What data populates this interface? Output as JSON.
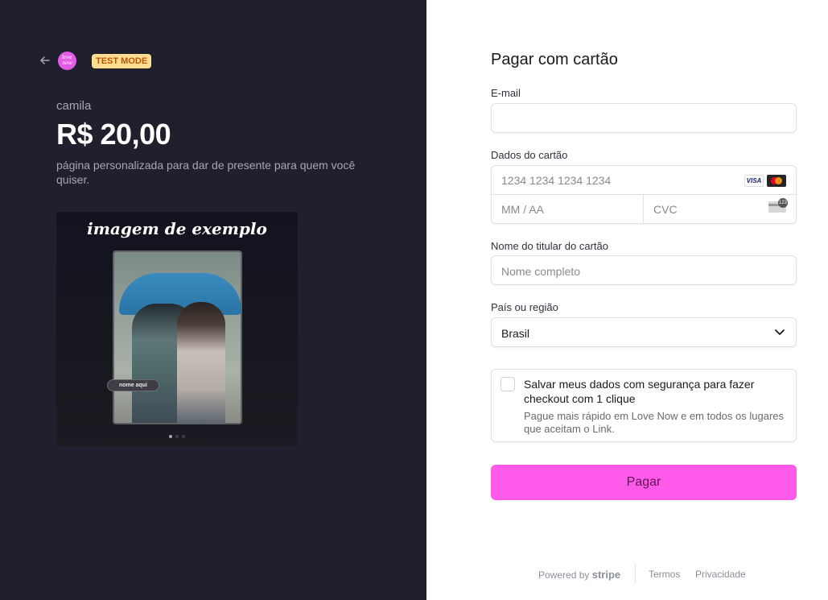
{
  "left": {
    "merchant_name": "camila",
    "price": "R$ 20,00",
    "description": "página personalizada para dar de presente para quem você quiser.",
    "test_badge": "TEST MODE",
    "logo_text": "love now",
    "preview": {
      "title": "imagem de exemplo",
      "name_tag": "nome aqui",
      "active_dot_index": 0,
      "dot_count": 3
    }
  },
  "form": {
    "title": "Pagar com cartão",
    "email_label": "E-mail",
    "email_value": "",
    "card_label": "Dados do cartão",
    "card_number_placeholder": "1234 1234 1234 1234",
    "card_brand_visa": "VISA",
    "expiry_placeholder": "MM / AA",
    "cvc_placeholder": "CVC",
    "cvc_icon_text": "123",
    "holder_label": "Nome do titular do cartão",
    "holder_placeholder": "Nome completo",
    "country_label": "País ou região",
    "country_value": "Brasil",
    "save_title": "Salvar meus dados com segurança para fazer checkout com 1 clique",
    "save_subtitle": "Pague mais rápido em Love Now e em todos os lugares que aceitam o Link.",
    "save_checked": false,
    "pay_button": "Pagar"
  },
  "footer": {
    "powered_by": "Powered by",
    "brand": "stripe",
    "terms": "Termos",
    "privacy": "Privacidade"
  },
  "colors": {
    "left_bg": "#1f1f2e",
    "accent": "#ff5ae9",
    "badge_bg": "#ffde92",
    "badge_text": "#bb5504"
  }
}
